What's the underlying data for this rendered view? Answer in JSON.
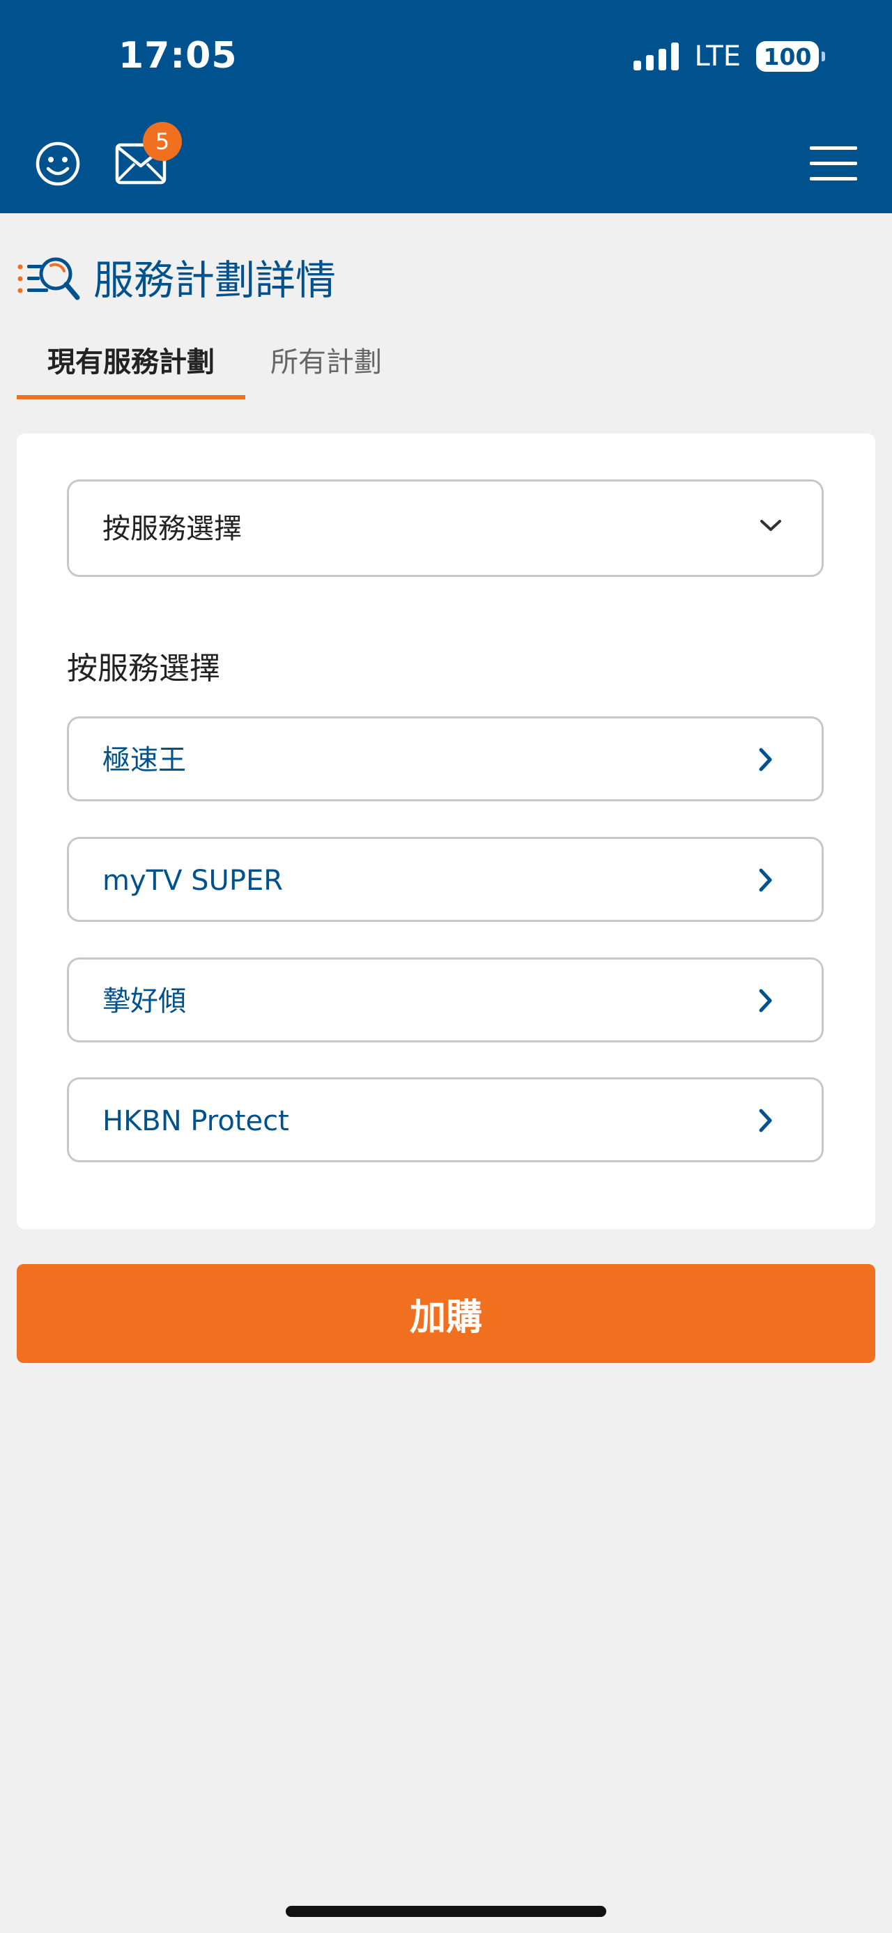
{
  "status_bar": {
    "time": "17:05",
    "network": "LTE",
    "battery": "100"
  },
  "header": {
    "mail_badge_count": "5",
    "icons": [
      "smiley-icon",
      "mail-icon",
      "menu-icon"
    ]
  },
  "page": {
    "title": "服務計劃詳情"
  },
  "tabs": [
    {
      "label": "現有服務計劃",
      "active": true
    },
    {
      "label": "所有計劃",
      "active": false
    }
  ],
  "selector": {
    "selected": "按服務選擇"
  },
  "services": {
    "heading": "按服務選擇",
    "items": [
      {
        "label": "極速王"
      },
      {
        "label": "myTV SUPER"
      },
      {
        "label": "摯好傾"
      },
      {
        "label": "HKBN Protect"
      }
    ]
  },
  "actions": {
    "add_label": "加購"
  },
  "colors": {
    "brand_blue": "#00528f",
    "accent_orange": "#f07020",
    "background": "#f0f0f0"
  }
}
